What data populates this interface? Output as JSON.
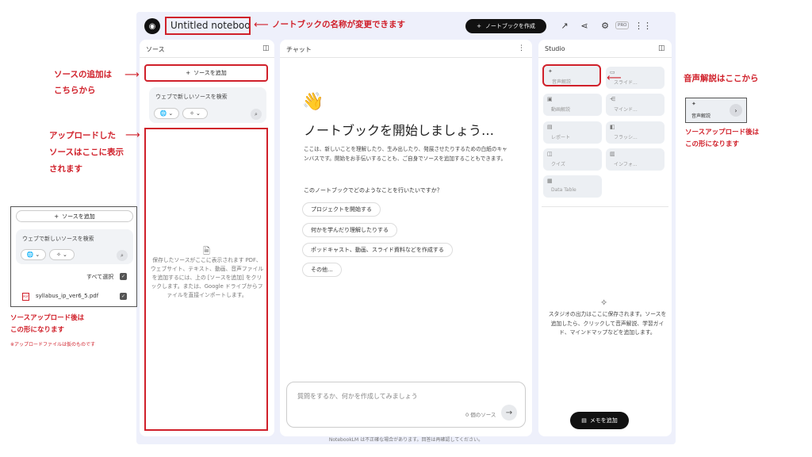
{
  "topbar": {
    "logo": "notebooklm-logo",
    "title": "Untitled notebook",
    "create_label": "ノートブックを作成",
    "plus": "+",
    "pro": "PRO"
  },
  "sources": {
    "header": "ソース",
    "add_label": "ソースを追加",
    "plus": "+",
    "search_label": "ウェブで新しいソースを検索",
    "empty_text": "保存したソースがここに表示されます PDF、ウェブサイト、テキスト、動画、音声ファイルを追加するには、上の [ソースを追加] をクリックします。または、Google ドライブからファイルを直接インポートします。"
  },
  "chat": {
    "header": "チャット",
    "emoji": "👋",
    "title": "ノートブックを開始しましょう…",
    "description": "ここは、新しいことを理解したり、生み出したり、発展させたりするための白紙のキャンバスです。開始をお手伝いすることも、ご自身でソースを追加することもできます。",
    "question": "このノートブックでどのようなことを行いたいですか？",
    "suggestions": [
      "プロジェクトを開始する",
      "何かを学んだり理解したりする",
      "ポッドキャスト、動画、スライド資料などを作成する",
      "その他..."
    ],
    "input_placeholder": "質問をするか、何かを作成してみましょう",
    "source_count": "0 個のソース",
    "send": "→"
  },
  "studio": {
    "header": "Studio",
    "tiles": [
      {
        "label": "音声解説",
        "icon": "audio-overview-icon"
      },
      {
        "label": "スライド...",
        "icon": "slides-icon"
      },
      {
        "label": "動画解説",
        "icon": "video-overview-icon"
      },
      {
        "label": "マインド...",
        "icon": "mindmap-icon"
      },
      {
        "label": "レポート",
        "icon": "report-icon"
      },
      {
        "label": "フラッシ...",
        "icon": "flashcards-icon"
      },
      {
        "label": "クイズ",
        "icon": "quiz-icon"
      },
      {
        "label": "インフォ...",
        "icon": "infographic-icon"
      },
      {
        "label": "Data Table",
        "icon": "data-table-icon"
      }
    ],
    "empty_text": "スタジオの出力はここに保存されます。ソースを追加したら、クリックして音声解説、学習ガイド、マインドマップなどを追加します。",
    "memo_label": "メモを追加"
  },
  "footer": "NotebookLM は不正確な場合があります。回答は再確認してください。",
  "annotations": {
    "rename": "ノートブックの名称が変更できます",
    "add_source": [
      "ソースの追加は",
      "こちらから"
    ],
    "uploaded": [
      "アップロードした",
      "ソースはここに表示",
      "されます"
    ],
    "audio": "音声解説はここから",
    "after_upload_right": [
      "ソースアップロード後は",
      "この形になります"
    ],
    "after_upload_left": [
      "ソースアップロード後は",
      "この形になります"
    ],
    "file_note": "※アップロードファイルは仮のものです"
  },
  "sample_left": {
    "add_label": "ソースを追加",
    "plus": "+",
    "search_label": "ウェブで新しいソースを検索",
    "select_all": "すべて選択",
    "file_name": "syllabus_ip_ver6_5.pdf",
    "pdf_badge": "PDF"
  },
  "sample_right": {
    "label": "音声解説"
  },
  "colors": {
    "annotation_red": "#d0202a",
    "frame_bg": "#eef0fb",
    "dark_button": "#111111"
  }
}
